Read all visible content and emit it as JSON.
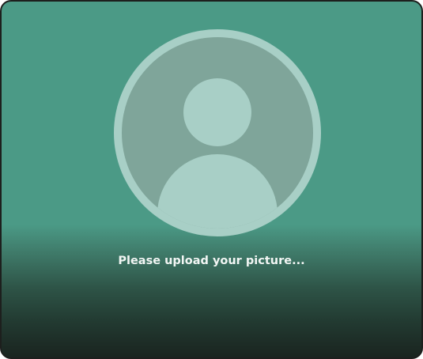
{
  "upload_card": {
    "prompt": "Please upload your picture..."
  },
  "avatar": {
    "icon": "default-user-avatar-icon"
  },
  "colors": {
    "background_top": "#4b9a86",
    "background_bottom": "#1a241f",
    "avatar_light": "#a8cfc6",
    "avatar_mid": "#7fa59a",
    "text": "#f2f6f4"
  }
}
